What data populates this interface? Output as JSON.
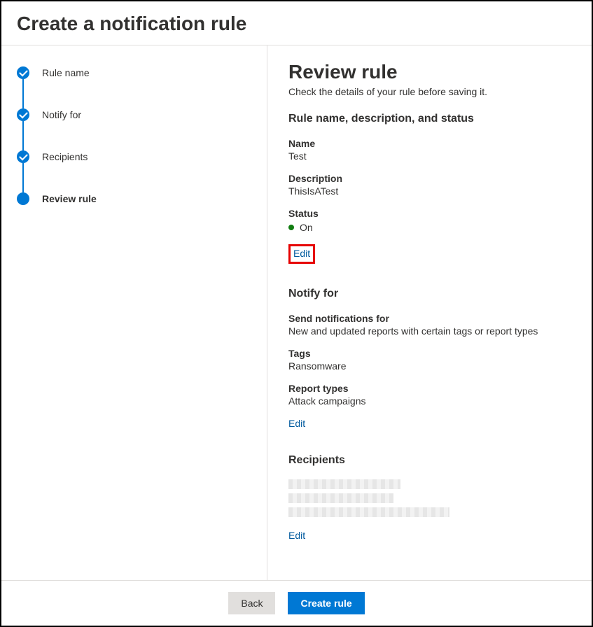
{
  "dialog_title": "Create a notification rule",
  "steps": [
    {
      "label": "Rule name",
      "state": "done"
    },
    {
      "label": "Notify for",
      "state": "done"
    },
    {
      "label": "Recipients",
      "state": "done"
    },
    {
      "label": "Review rule",
      "state": "current"
    }
  ],
  "review": {
    "title": "Review rule",
    "subtitle": "Check the details of your rule before saving it.",
    "section1": {
      "heading": "Rule name, description, and status",
      "name_label": "Name",
      "name_value": "Test",
      "description_label": "Description",
      "description_value": "ThisIsATest",
      "status_label": "Status",
      "status_value": "On",
      "status_color": "#107c10",
      "edit_label": "Edit"
    },
    "section2": {
      "heading": "Notify for",
      "send_label": "Send notifications for",
      "send_value": "New and updated reports with certain tags or report types",
      "tags_label": "Tags",
      "tags_value": "Ransomware",
      "report_types_label": "Report types",
      "report_types_value": "Attack campaigns",
      "edit_label": "Edit"
    },
    "section3": {
      "heading": "Recipients",
      "edit_label": "Edit"
    }
  },
  "footer": {
    "back_label": "Back",
    "create_label": "Create rule"
  }
}
